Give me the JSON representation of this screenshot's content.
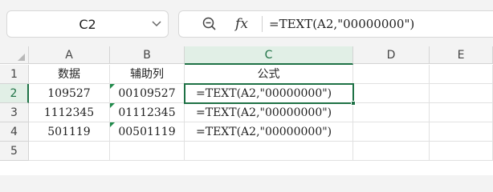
{
  "name_box": {
    "value": "C2"
  },
  "formula_bar": {
    "fx_label": "fx",
    "content": "=TEXT(A2,\"00000000\")"
  },
  "columns": [
    "A",
    "B",
    "C",
    "D",
    "E"
  ],
  "rows": [
    "1",
    "2",
    "3",
    "4",
    "5"
  ],
  "cells": {
    "A1": "数据",
    "B1": "辅助列",
    "C1": "公式",
    "A2": "109527",
    "B2": "00109527",
    "C2": "=TEXT(A2,\"00000000\")",
    "A3": "1112345",
    "B3": "01112345",
    "C3": "=TEXT(A2,\"00000000\")",
    "A4": "501119",
    "B4": "00501119",
    "C4": "=TEXT(A2,\"00000000\")"
  },
  "active_cell": "C2",
  "colors": {
    "accent": "#1e7145",
    "text_flag": "#1f8a4a"
  },
  "icons": {
    "name_box_dropdown": "chevron-down-icon",
    "zoom": "zoom-icon"
  }
}
